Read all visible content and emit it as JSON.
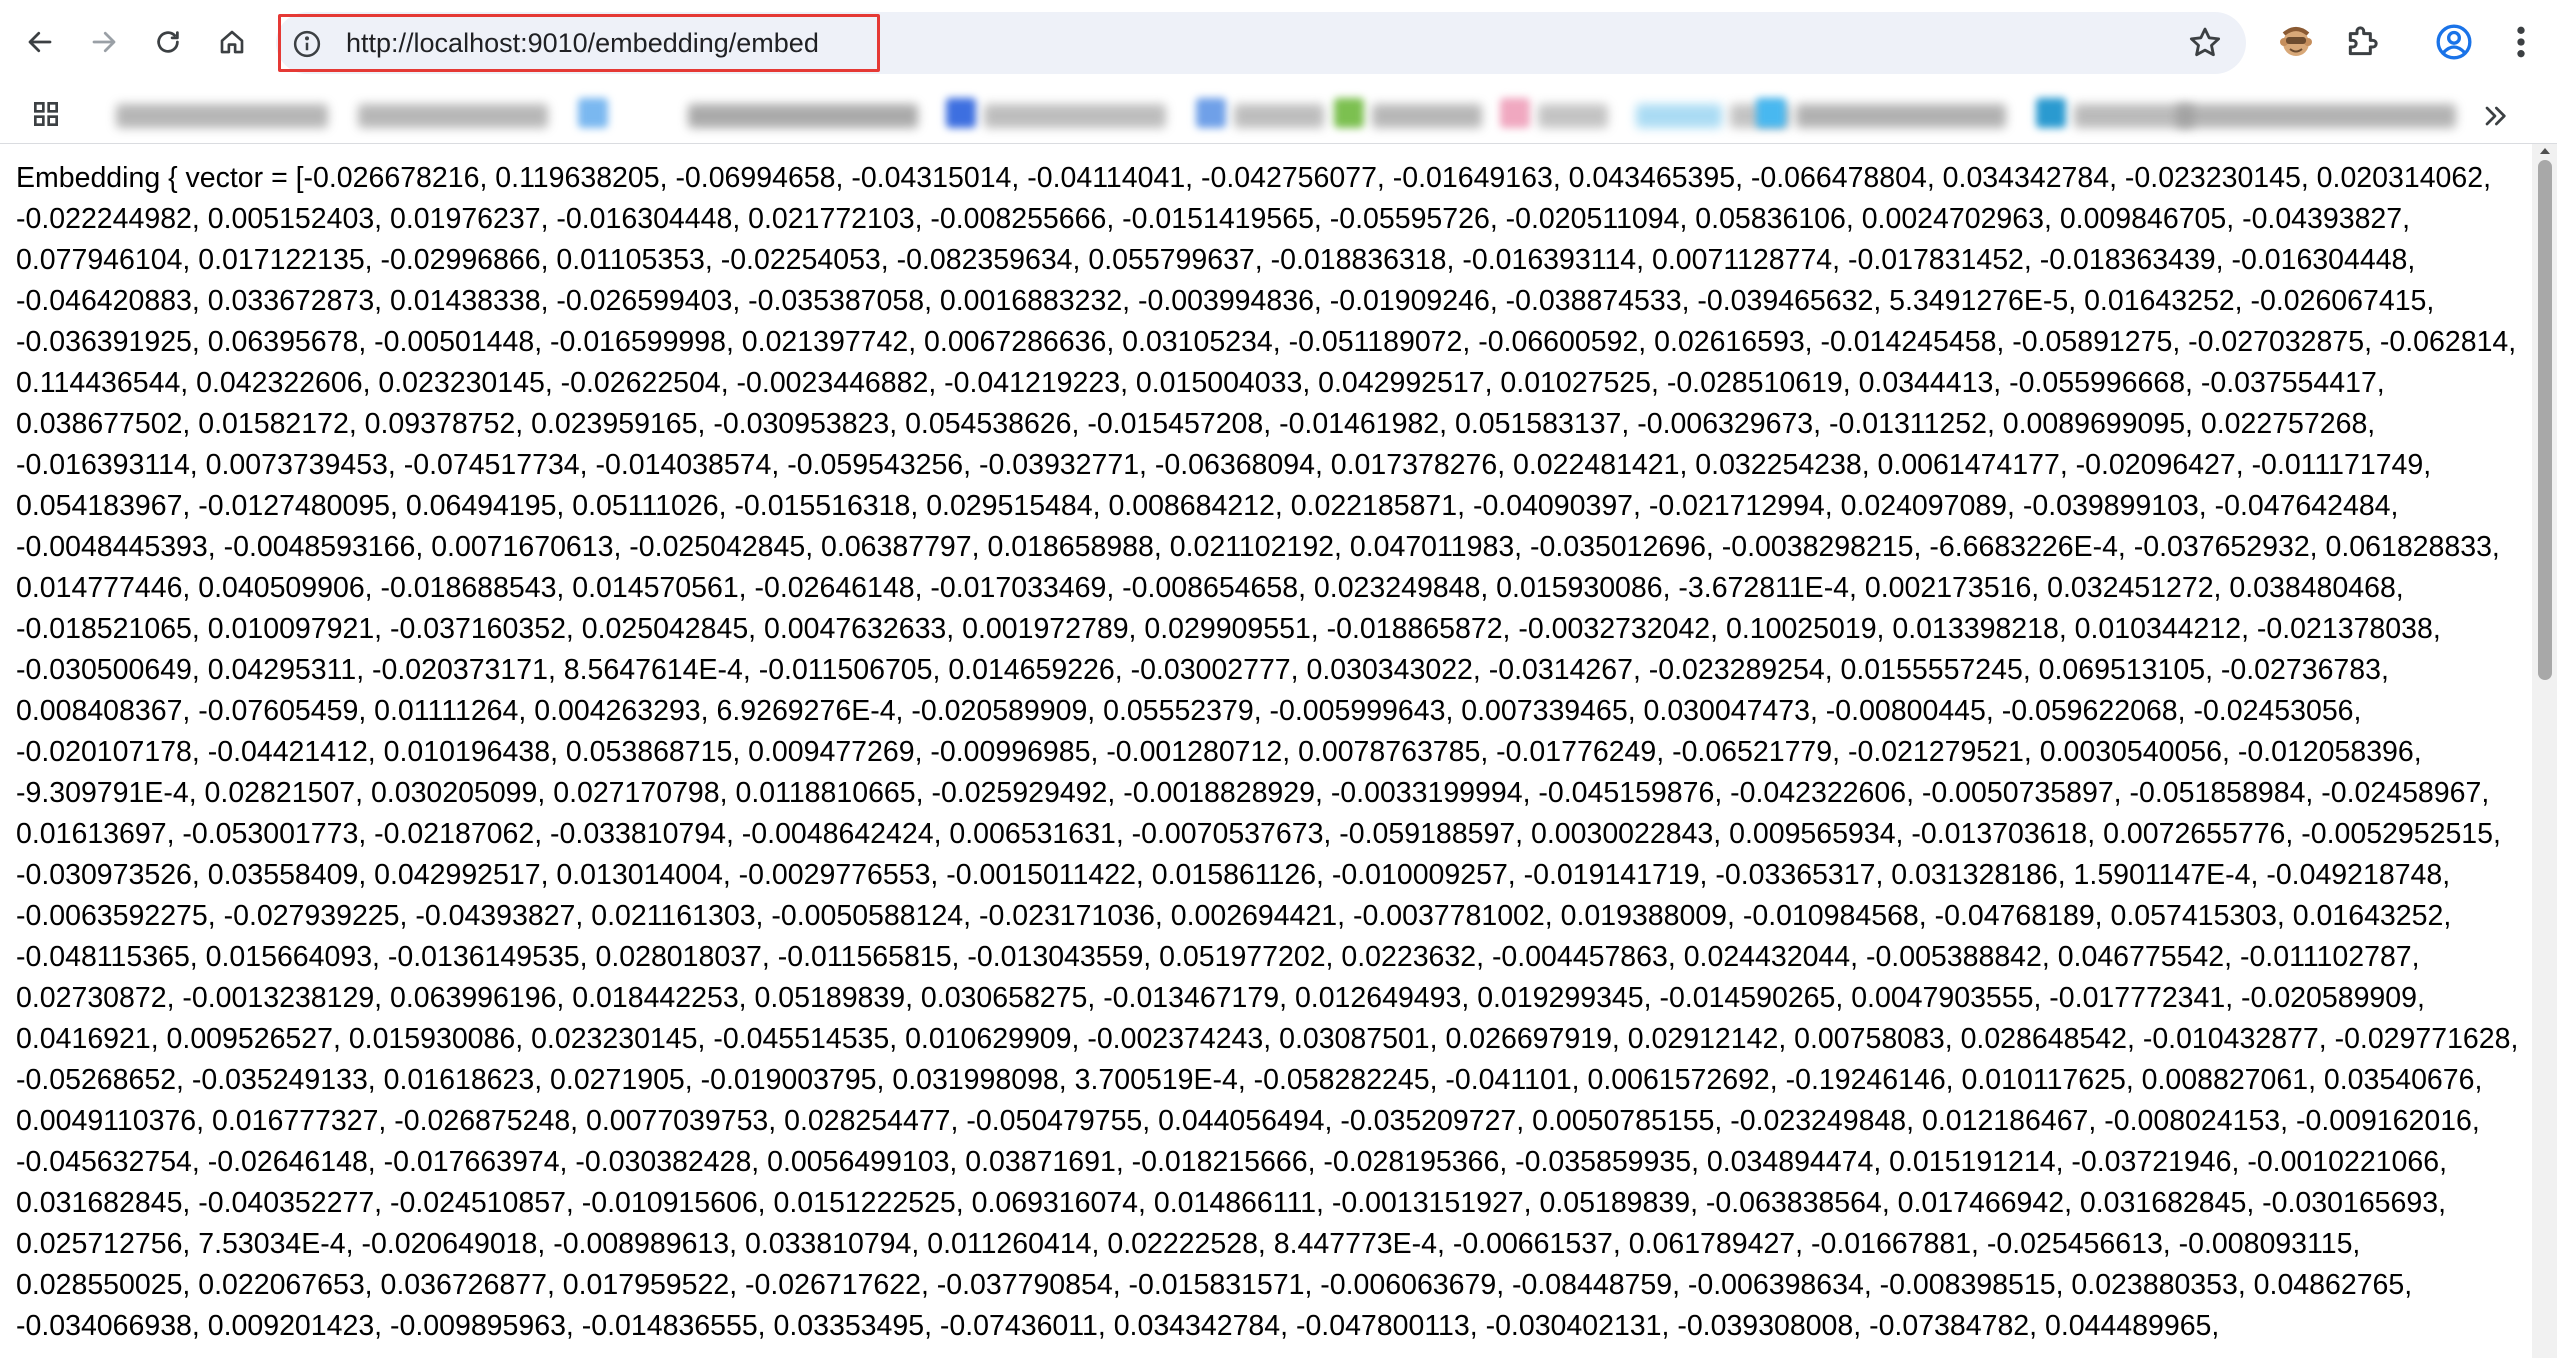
{
  "browser": {
    "url": "http://localhost:9010/embedding/embed",
    "icons": {
      "back": "back-arrow-icon",
      "forward": "forward-arrow-icon",
      "reload": "reload-icon",
      "home": "home-icon",
      "site_info": "info-icon",
      "bookmark": "star-icon",
      "extension": "extension-icon",
      "extensions_menu": "puzzle-icon",
      "profile": "profile-icon",
      "menu": "kebab-menu-icon",
      "apps": "apps-grid-icon",
      "bookmarks_overflow": "chevron-double-right-icon"
    },
    "colors": {
      "highlight_border": "#e53935",
      "omnibox_bg": "#eef1f8",
      "profile_accent": "#1a73e8"
    }
  },
  "page": {
    "embedding_text": "Embedding { vector = [-0.026678216, 0.119638205, -0.06994658, -0.04315014, -0.04114041, -0.042756077, -0.01649163, 0.043465395, -0.066478804, 0.034342784, -0.023230145, 0.020314062, -0.022244982, 0.005152403, 0.01976237, -0.016304448, 0.021772103, -0.008255666, -0.0151419565, -0.05595726, -0.020511094, 0.05836106, 0.0024702963, 0.009846705, -0.04393827, 0.077946104, 0.017122135, -0.02996866, 0.01105353, -0.02254053, -0.082359634, 0.055799637, -0.018836318, -0.016393114, 0.0071128774, -0.017831452, -0.018363439, -0.016304448, -0.046420883, 0.033672873, 0.01438338, -0.026599403, -0.035387058, 0.0016883232, -0.003994836, -0.01909246, -0.038874533, -0.039465632, 5.3491276E-5, 0.01643252, -0.026067415, -0.036391925, 0.06395678, -0.00501448, -0.016599998, 0.021397742, 0.0067286636, 0.03105234, -0.051189072, -0.06600592, 0.02616593, -0.014245458, -0.05891275, -0.027032875, -0.062814, 0.114436544, 0.042322606, 0.023230145, -0.02622504, -0.0023446882, -0.041219223, 0.015004033, 0.042992517, 0.01027525, -0.028510619, 0.0344413, -0.055996668, -0.037554417, 0.038677502, 0.01582172, 0.09378752, 0.023959165, -0.030953823, 0.054538626, -0.015457208, -0.01461982, 0.051583137, -0.006329673, -0.01311252, 0.0089699095, 0.022757268, -0.016393114, 0.0073739453, -0.074517734, -0.014038574, -0.059543256, -0.03932771, -0.06368094, 0.017378276, 0.022481421, 0.032254238, 0.0061474177, -0.02096427, -0.011171749, 0.054183967, -0.0127480095, 0.06494195, 0.05111026, -0.015516318, 0.029515484, 0.008684212, 0.022185871, -0.04090397, -0.021712994, 0.024097089, -0.039899103, -0.047642484, -0.0048445393, -0.0048593166, 0.0071670613, -0.025042845, 0.06387797, 0.018658988, 0.021102192, 0.047011983, -0.035012696, -0.0038298215, -6.6683226E-4, -0.037652932, 0.061828833, 0.014777446, 0.040509906, -0.018688543, 0.014570561, -0.02646148, -0.017033469, -0.008654658, 0.023249848, 0.015930086, -3.672811E-4, 0.002173516, 0.032451272, 0.038480468, -0.018521065, 0.010097921, -0.037160352, 0.025042845, 0.0047632633, 0.001972789, 0.029909551, -0.018865872, -0.0032732042, 0.10025019, 0.013398218, 0.010344212, -0.021378038, -0.030500649, 0.04295311, -0.020373171, 8.5647614E-4, -0.011506705, 0.014659226, -0.03002777, 0.030343022, -0.0314267, -0.023289254, 0.0155557245, 0.069513105, -0.02736783, 0.008408367, -0.07605459, 0.01111264, 0.004263293, 6.9269276E-4, -0.020589909, 0.05552379, -0.005999643, 0.007339465, 0.030047473, -0.00800445, -0.059622068, -0.02453056, -0.020107178, -0.04421412, 0.010196438, 0.053868715, 0.009477269, -0.00996985, -0.001280712, 0.0078763785, -0.01776249, -0.06521779, -0.021279521, 0.0030540056, -0.012058396, -9.309791E-4, 0.02821507, 0.030205099, 0.027170798, 0.0118810665, -0.025929492, -0.0018828929, -0.0033199994, -0.045159876, -0.042322606, -0.0050735897, -0.051858984, -0.02458967, 0.01613697, -0.053001773, -0.02187062, -0.033810794, -0.0048642424, 0.006531631, -0.0070537673, -0.059188597, 0.0030022843, 0.009565934, -0.013703618, 0.0072655776, -0.0052952515, -0.030973526, 0.03558409, 0.042992517, 0.013014004, -0.0029776553, -0.0015011422, 0.015861126, -0.010009257, -0.019141719, -0.03365317, 0.031328186, 1.5901147E-4, -0.049218748, -0.0063592275, -0.027939225, -0.04393827, 0.021161303, -0.0050588124, -0.023171036, 0.002694421, -0.0037781002, 0.019388009, -0.010984568, -0.04768189, 0.057415303, 0.01643252, -0.048115365, 0.015664093, -0.0136149535, 0.028018037, -0.011565815, -0.013043559, 0.051977202, 0.0223632, -0.004457863, 0.024432044, -0.005388842, 0.046775542, -0.011102787, 0.02730872, -0.0013238129, 0.063996196, 0.018442253, 0.05189839, 0.030658275, -0.013467179, 0.012649493, 0.019299345, -0.014590265, 0.0047903555, -0.017772341, -0.020589909, 0.0416921, 0.009526527, 0.015930086, 0.023230145, -0.045514535, 0.010629909, -0.002374243, 0.03087501, 0.026697919, 0.02912142, 0.00758083, 0.028648542, -0.010432877, -0.029771628, -0.05268652, -0.035249133, 0.01618623, 0.0271905, -0.019003795, 0.031998098, 3.700519E-4, -0.058282245, -0.041101, 0.0061572692, -0.19246146, 0.010117625, 0.008827061, 0.03540676, 0.0049110376, 0.016777327, -0.026875248, 0.0077039753, 0.028254477, -0.050479755, 0.044056494, -0.035209727, 0.0050785155, -0.023249848, 0.012186467, -0.008024153, -0.009162016, -0.045632754, -0.02646148, -0.017663974, -0.030382428, 0.0056499103, 0.03871691, -0.018215666, -0.028195366, -0.035859935, 0.034894474, 0.015191214, -0.03721946, -0.0010221066, 0.031682845, -0.040352277, -0.024510857, -0.010915606, 0.0151222525, 0.069316074, 0.014866111, -0.0013151927, 0.05189839, -0.063838564, 0.017466942, 0.031682845, -0.030165693, 0.025712756, 7.53034E-4, -0.020649018, -0.008989613, 0.033810794, 0.011260414, 0.02222528, 8.447773E-4, -0.00661537, 0.061789427, -0.01667881, -0.025456613, -0.008093115, 0.028550025, 0.022067653, 0.036726877, 0.017959522, -0.026717622, -0.037790854, -0.015831571, -0.006063679, -0.08448759, -0.006398634, -0.008398515, 0.023880353, 0.04862765, -0.034066938, 0.009201423, -0.009895963, -0.014836555, 0.03353495, -0.07436011, 0.034342784, -0.047800113, -0.030402131, -0.039308008, -0.07384782, 0.044489965,"
  }
}
